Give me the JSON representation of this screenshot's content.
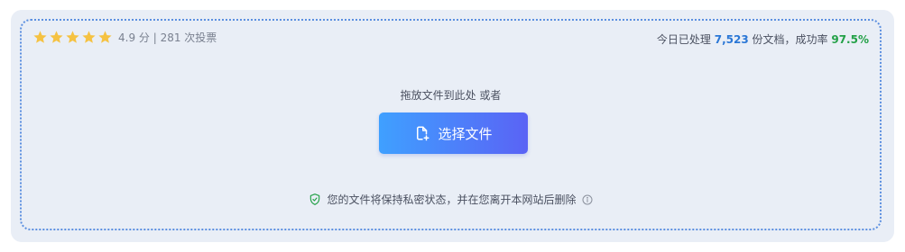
{
  "rating": {
    "stars": 5,
    "score_text": "4.9 分 | 281 次投票"
  },
  "stats": {
    "prefix": "今日已处理",
    "processed_count": "7,523",
    "middle": "份文档，成功率",
    "success_rate": "97.5%"
  },
  "dropzone": {
    "hint": "拖放文件到此处 或者",
    "select_button_label": "选择文件"
  },
  "privacy": {
    "text": "您的文件将保持私密状态，并在您离开本网站后删除"
  },
  "icons": {
    "star": "star-icon",
    "file_plus": "file-plus-icon",
    "shield": "shield-check-icon",
    "info": "info-icon"
  },
  "colors": {
    "star": "#f5c242",
    "accent_blue": "#2a77d6",
    "accent_green": "#24a148",
    "button_start": "#3fa0ff",
    "button_end": "#5a63f5",
    "panel_bg": "#e9eef6",
    "dash_border": "#5b8fe0"
  }
}
